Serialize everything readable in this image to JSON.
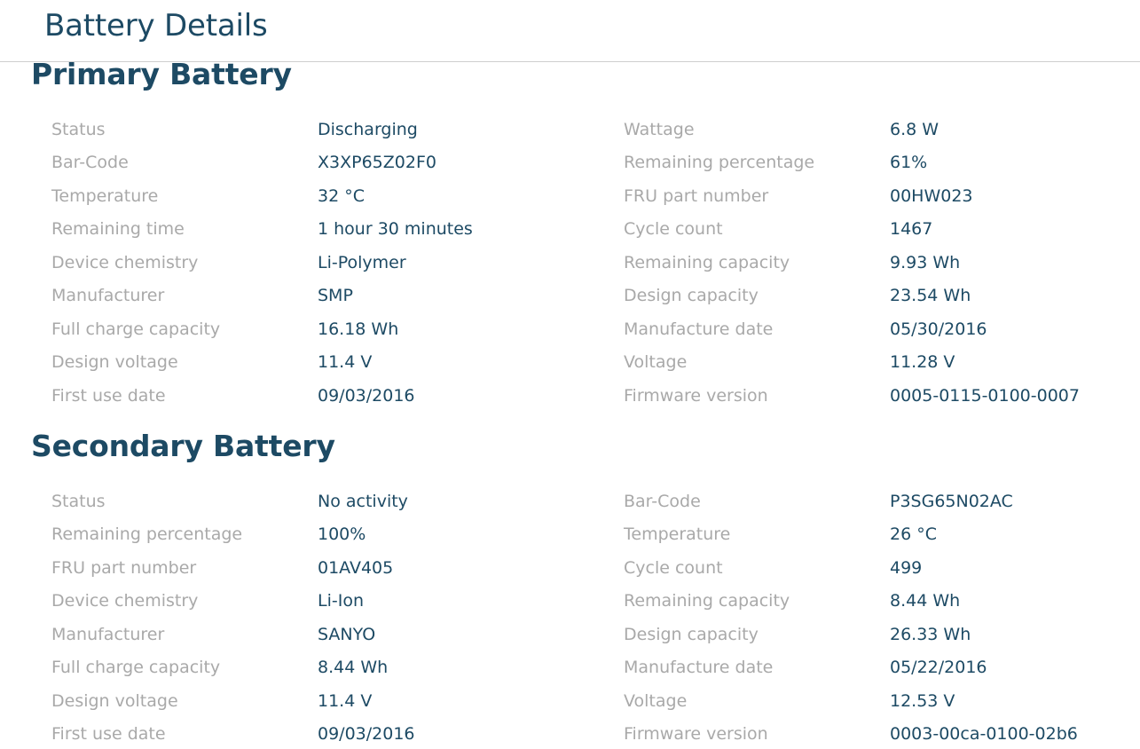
{
  "window": {
    "title": "Battery Details"
  },
  "primary": {
    "title": "Primary Battery",
    "rows": [
      {
        "l1": "Status",
        "v1": "Discharging",
        "l2": "Wattage",
        "v2": "6.8 W"
      },
      {
        "l1": "Bar-Code",
        "v1": "X3XP65Z02F0",
        "l2": "Remaining percentage",
        "v2": "61%"
      },
      {
        "l1": "Temperature",
        "v1": "32 °C",
        "l2": "FRU part number",
        "v2": "00HW023"
      },
      {
        "l1": "Remaining time",
        "v1": "1 hour 30 minutes",
        "l2": "Cycle count",
        "v2": "1467"
      },
      {
        "l1": "Device chemistry",
        "v1": "Li-Polymer",
        "l2": "Remaining capacity",
        "v2": "9.93 Wh"
      },
      {
        "l1": "Manufacturer",
        "v1": "SMP",
        "l2": "Design capacity",
        "v2": "23.54 Wh"
      },
      {
        "l1": "Full charge capacity",
        "v1": "16.18 Wh",
        "l2": "Manufacture date",
        "v2": "05/30/2016"
      },
      {
        "l1": "Design voltage",
        "v1": "11.4 V",
        "l2": "Voltage",
        "v2": "11.28 V"
      },
      {
        "l1": "First use date",
        "v1": "09/03/2016",
        "l2": "Firmware version",
        "v2": "0005-0115-0100-0007"
      }
    ]
  },
  "secondary": {
    "title": "Secondary Battery",
    "rows": [
      {
        "l1": "Status",
        "v1": "No activity",
        "l2": "Bar-Code",
        "v2": "P3SG65N02AC"
      },
      {
        "l1": "Remaining percentage",
        "v1": "100%",
        "l2": "Temperature",
        "v2": "26 °C"
      },
      {
        "l1": "FRU part number",
        "v1": "01AV405",
        "l2": "Cycle count",
        "v2": "499"
      },
      {
        "l1": "Device chemistry",
        "v1": "Li-Ion",
        "l2": "Remaining capacity",
        "v2": "8.44 Wh"
      },
      {
        "l1": "Manufacturer",
        "v1": "SANYO",
        "l2": "Design capacity",
        "v2": "26.33 Wh"
      },
      {
        "l1": "Full charge capacity",
        "v1": "8.44 Wh",
        "l2": "Manufacture date",
        "v2": "05/22/2016"
      },
      {
        "l1": "Design voltage",
        "v1": "11.4 V",
        "l2": "Voltage",
        "v2": "12.53 V"
      },
      {
        "l1": "First use date",
        "v1": "09/03/2016",
        "l2": "Firmware version",
        "v2": "0003-00ca-0100-02b6"
      }
    ]
  },
  "colors": {
    "heading": "#1d4a64",
    "label": "#a9a9a9",
    "value": "#1d4a64",
    "divider": "#cfcfcf"
  }
}
